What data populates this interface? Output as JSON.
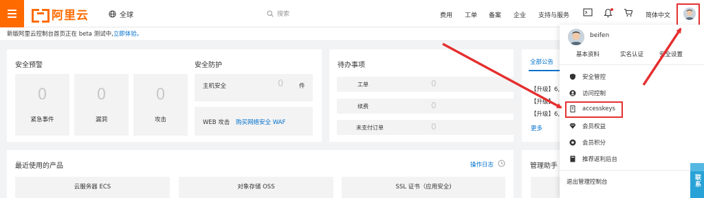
{
  "header": {
    "logo_text": "阿里云",
    "region_label": "全球",
    "search_placeholder": "搜索",
    "nav": [
      "费用",
      "工单",
      "备案",
      "企业",
      "支持与服务"
    ],
    "language": "简体中文"
  },
  "notice": {
    "text": "新版阿里云控制台首页正在 beta 测试中,",
    "link": "立即体验。"
  },
  "security_alert": {
    "title": "安全预警",
    "tiles": [
      {
        "value": "0",
        "label": "紧急事件"
      },
      {
        "value": "0",
        "label": "漏洞"
      },
      {
        "value": "0",
        "label": "攻击"
      }
    ]
  },
  "security_protection": {
    "title": "安全防护",
    "host_label": "主机安全",
    "host_value": "0",
    "host_unit": "件",
    "web_label": "WEB 攻击",
    "web_link": "购买网络安全 WAF"
  },
  "todo": {
    "title": "待办事项",
    "rows": [
      {
        "label": "工单",
        "value": "0"
      },
      {
        "label": "续费",
        "value": "0"
      },
      {
        "label": "未支付订单",
        "value": "0"
      }
    ]
  },
  "announcements": {
    "tab": "全部公告",
    "items": [
      "【升级】6,",
      "【升级】",
      "【升级】6,"
    ],
    "more": "更多"
  },
  "recent_products": {
    "title": "最近使用的产品",
    "log_link": "操作日志",
    "items": [
      "云服务器 ECS",
      "对象存储 OSS",
      "SSL 证书（应用安全)"
    ]
  },
  "assistant": {
    "title": "管理助手"
  },
  "user_menu": {
    "username": "beifen",
    "links": [
      "基本资料",
      "实名认证",
      "安全设置"
    ],
    "items": [
      {
        "label": "安全管控",
        "icon": "shield-icon"
      },
      {
        "label": "访问控制",
        "icon": "user-icon"
      },
      {
        "label": "accesskeys",
        "icon": "key-card-icon"
      },
      {
        "label": "会员权益",
        "icon": "diamond-icon"
      },
      {
        "label": "会员积分",
        "icon": "coin-icon"
      },
      {
        "label": "推荐返利后台",
        "icon": "book-icon"
      }
    ],
    "exit": "退出管理控制台"
  },
  "contact": {
    "label": "联系"
  },
  "colors": {
    "brand": "#ff6a00",
    "link": "#0070cc",
    "annotation": "#e52f2f",
    "contact": "#29a3d7"
  }
}
